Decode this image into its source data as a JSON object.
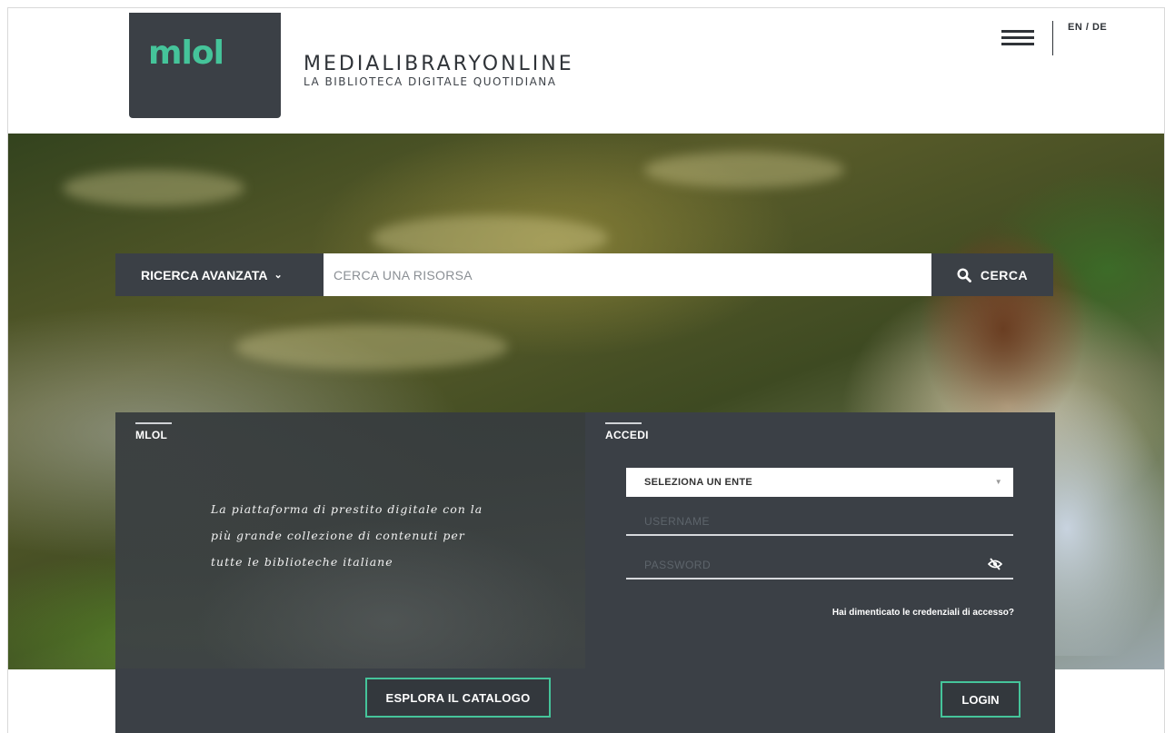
{
  "header": {
    "logo_text": "mlol",
    "brand_title": "MEDIALIBRARYONLINE",
    "brand_subtitle": "LA BIBLIOTECA DIGITALE QUOTIDIANA",
    "language_switch": "EN / DE",
    "menu_icon": "hamburger-menu-icon"
  },
  "search": {
    "advanced_label": "RICERCA AVANZATA",
    "placeholder": "CERCA UNA RISORSA",
    "button_label": "CERCA"
  },
  "left_panel": {
    "tag": "MLOL",
    "tagline": "La piattaforma di prestito digitale con la più grande collezione di contenuti per tutte le biblioteche italiane",
    "explore_label": "ESPLORA IL CATALOGO"
  },
  "right_panel": {
    "tag": "ACCEDI",
    "select_ente": "SELEZIONA UN ENTE",
    "username_placeholder": "USERNAME",
    "password_placeholder": "PASSWORD",
    "forgot_label": "Hai dimenticato le credenziali di accesso?",
    "login_label": "LOGIN"
  },
  "colors": {
    "accent": "#45c49a",
    "dark": "#3b4046"
  }
}
